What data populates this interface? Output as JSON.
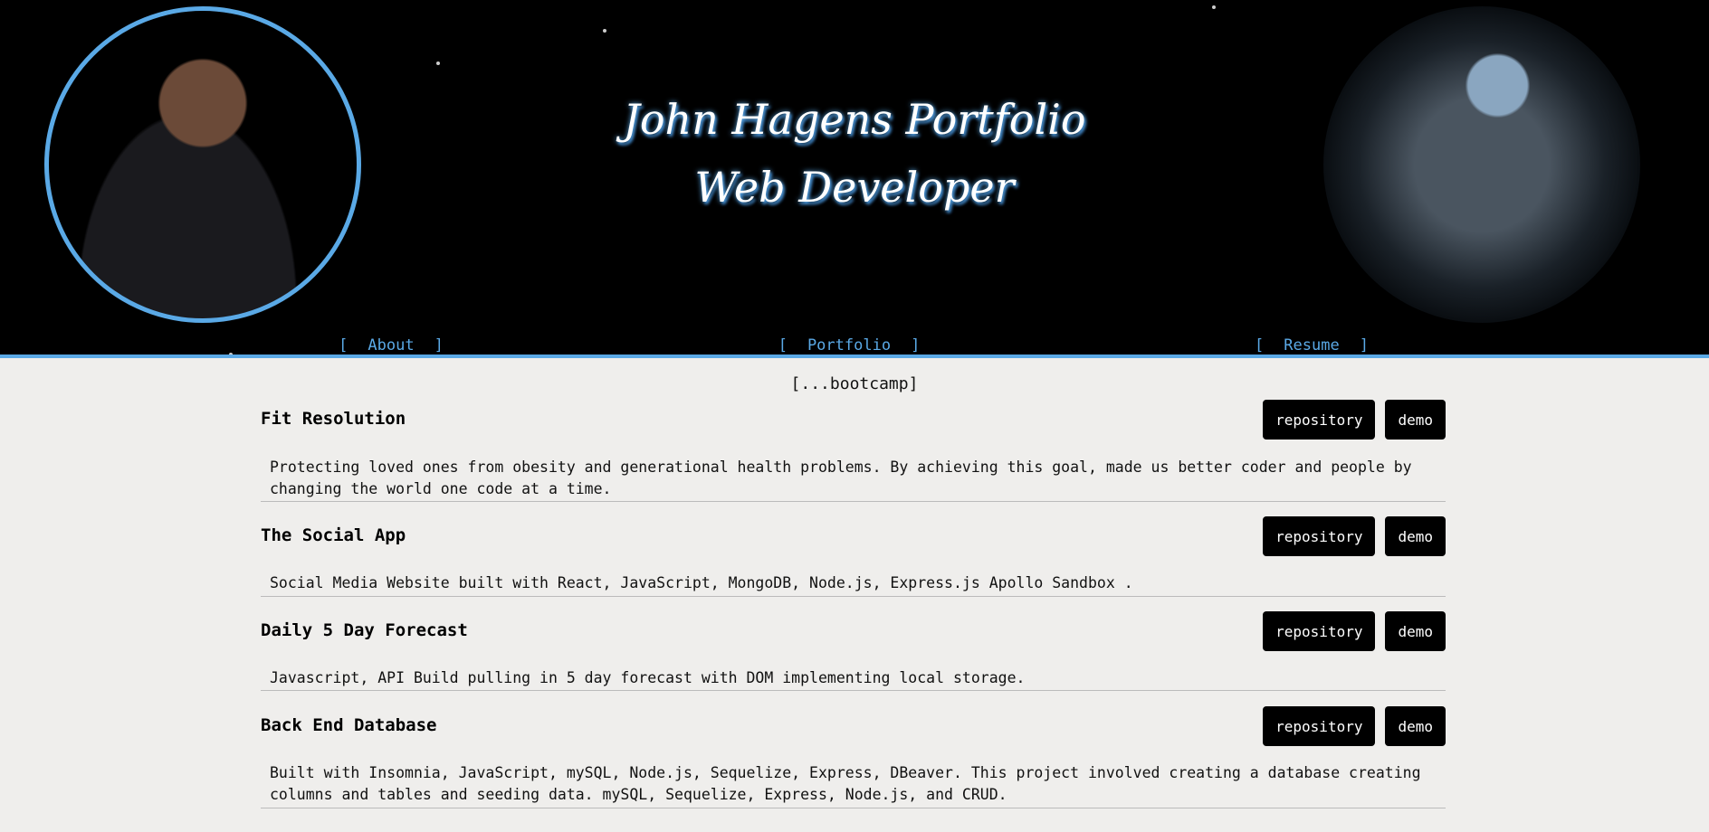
{
  "header": {
    "title_line1": "John Hagens Portfolio",
    "title_line2": "Web Developer"
  },
  "nav": {
    "items": [
      {
        "label": "About"
      },
      {
        "label": "Portfolio"
      },
      {
        "label": "Resume"
      }
    ]
  },
  "section": {
    "heading": "[...bootcamp]"
  },
  "buttons": {
    "repository": "repository",
    "demo": "demo"
  },
  "projects": [
    {
      "title": "Fit Resolution",
      "description": "Protecting loved ones from obesity and generational health problems. By achieving this goal, made us better coder and people by changing the world one code at a time."
    },
    {
      "title": "The Social App",
      "description": "Social Media Website built with React, JavaScript, MongoDB, Node.js, Express.js Apollo Sandbox ."
    },
    {
      "title": "Daily 5 Day Forecast",
      "description": "Javascript, API Build pulling in 5 day forecast with DOM implementing local storage."
    },
    {
      "title": "Back End Database",
      "description": "Built with Insomnia, JavaScript, mySQL, Node.js, Sequelize, Express, DBeaver. This project involved creating a database creating columns and tables and seeding data. mySQL, Sequelize, Express, Node.js, and CRUD."
    }
  ],
  "colors": {
    "accent": "#5aa9e6",
    "header_bg": "#000000",
    "page_bg": "#efeeec"
  }
}
